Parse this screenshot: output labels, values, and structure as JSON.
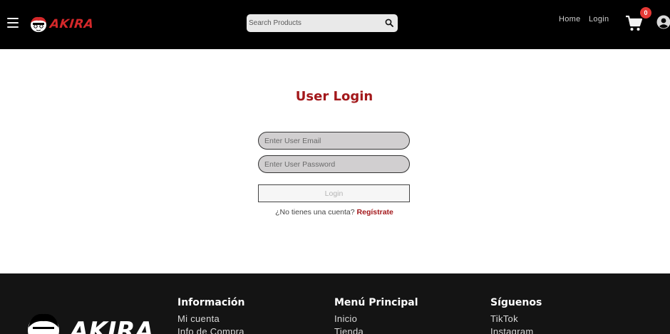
{
  "navbar": {
    "logo_text": "AKIRA",
    "search_placeholder": "Search Products",
    "links": {
      "home": "Home",
      "login": "Login"
    },
    "cart_count": "0",
    "icons": {
      "menu": "hamburger-icon",
      "search": "search-icon",
      "cart": "cart-icon",
      "user": "user-icon"
    }
  },
  "login": {
    "title": "User Login",
    "email_placeholder": "Enter User Email",
    "password_placeholder": "Enter User Password",
    "button_label": "Login",
    "register_prompt": "¿No tienes una cuenta?",
    "register_link": "Regístrate"
  },
  "footer": {
    "logo_text": "AKIRA",
    "columns": [
      {
        "heading": "Información",
        "links": [
          "Mi cuenta",
          "Info de Compra"
        ]
      },
      {
        "heading": "Menú Principal",
        "links": [
          "Inicio",
          "Tienda"
        ]
      },
      {
        "heading": "Síguenos",
        "links": [
          "TikTok",
          "Instagram"
        ]
      }
    ]
  },
  "colors": {
    "brand_red": "#a3181b",
    "logo_red": "#d4282a",
    "badge_red": "#e53935",
    "navbar_bg": "#000000",
    "footer_bg": "#141414",
    "input_bg": "#d1cfd0"
  }
}
